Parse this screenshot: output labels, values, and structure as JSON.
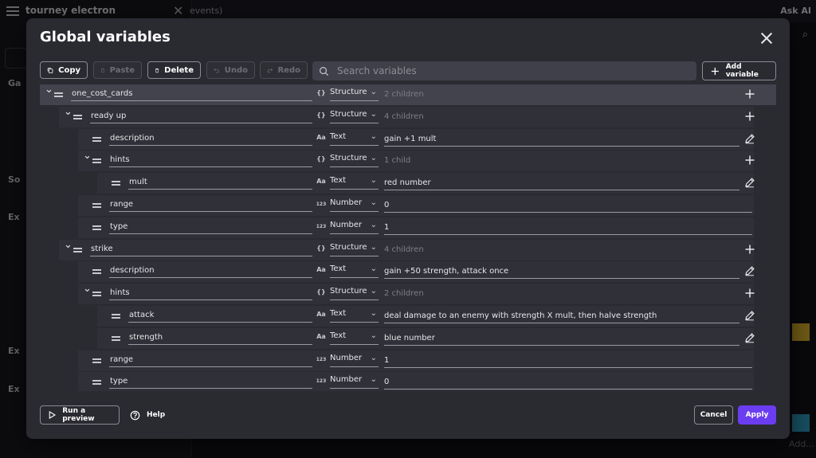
{
  "background": {
    "app_title": "tourney electron",
    "tab_text": "events)",
    "ask_ai_label": "Ask AI",
    "sidebar_sections": [
      "Ga",
      "So",
      "Ex",
      "Ex",
      "Ex"
    ],
    "add_label": "Add..."
  },
  "modal": {
    "title": "Global variables",
    "toolbar": {
      "copy": "Copy",
      "paste": "Paste",
      "delete": "Delete",
      "undo": "Undo",
      "redo": "Redo",
      "search_placeholder": "Search variables",
      "add_variable": "Add variable"
    },
    "rows": [
      {
        "name": "one_cost_cards",
        "depth": 0,
        "expandable": true,
        "type": "Structure",
        "type_icon": "{}",
        "value": "2 children",
        "value_dim": true,
        "action": "add",
        "selected": true
      },
      {
        "name": "ready up",
        "depth": 1,
        "expandable": true,
        "type": "Structure",
        "type_icon": "{}",
        "value": "4 children",
        "value_dim": true,
        "action": "add"
      },
      {
        "name": "description",
        "depth": 2,
        "expandable": false,
        "type": "Text",
        "type_icon": "Aa",
        "value": "gain +1 mult",
        "value_dim": false,
        "action": "edit"
      },
      {
        "name": "hints",
        "depth": 2,
        "expandable": true,
        "type": "Structure",
        "type_icon": "{}",
        "value": "1 child",
        "value_dim": true,
        "action": "add"
      },
      {
        "name": "mult",
        "depth": 3,
        "expandable": false,
        "type": "Text",
        "type_icon": "Aa",
        "value": "red number",
        "value_dim": false,
        "action": "edit"
      },
      {
        "name": "range",
        "depth": 2,
        "expandable": false,
        "type": "Number",
        "type_icon": "123",
        "value": "0",
        "value_dim": false,
        "action": "none"
      },
      {
        "name": "type",
        "depth": 2,
        "expandable": false,
        "type": "Number",
        "type_icon": "123",
        "value": "1",
        "value_dim": false,
        "action": "none"
      },
      {
        "name": "strike",
        "depth": 1,
        "expandable": true,
        "type": "Structure",
        "type_icon": "{}",
        "value": "4 children",
        "value_dim": true,
        "action": "add"
      },
      {
        "name": "description",
        "depth": 2,
        "expandable": false,
        "type": "Text",
        "type_icon": "Aa",
        "value": "gain +50 strength, attack once",
        "value_dim": false,
        "action": "edit"
      },
      {
        "name": "hints",
        "depth": 2,
        "expandable": true,
        "type": "Structure",
        "type_icon": "{}",
        "value": "2 children",
        "value_dim": true,
        "action": "add"
      },
      {
        "name": "attack",
        "depth": 3,
        "expandable": false,
        "type": "Text",
        "type_icon": "Aa",
        "value": "deal damage to an enemy with strength X mult, then halve strength",
        "value_dim": false,
        "action": "edit"
      },
      {
        "name": "strength",
        "depth": 3,
        "expandable": false,
        "type": "Text",
        "type_icon": "Aa",
        "value": "blue number",
        "value_dim": false,
        "action": "edit"
      },
      {
        "name": "range",
        "depth": 2,
        "expandable": false,
        "type": "Number",
        "type_icon": "123",
        "value": "1",
        "value_dim": false,
        "action": "none"
      },
      {
        "name": "type",
        "depth": 2,
        "expandable": false,
        "type": "Number",
        "type_icon": "123",
        "value": "0",
        "value_dim": false,
        "action": "none"
      }
    ],
    "footer": {
      "run_preview": "Run a preview",
      "help": "Help",
      "cancel": "Cancel",
      "apply": "Apply"
    }
  },
  "colors": {
    "accent": "#6b3df0",
    "modal_bg": "#2a2a31",
    "row_bg": "#303038",
    "row_selected": "#43434e"
  }
}
